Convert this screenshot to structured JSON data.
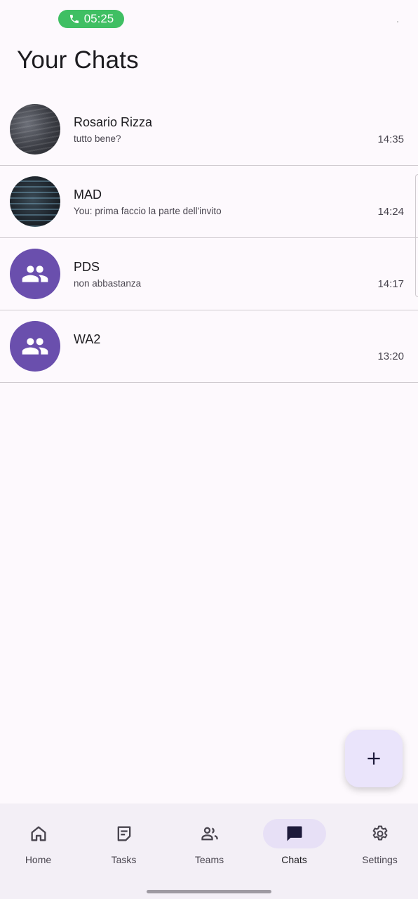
{
  "status_bar": {
    "call_time": "05:25",
    "call_icon": "phone-icon"
  },
  "page_title": "Your Chats",
  "chats": [
    {
      "name": "Rosario Rizza",
      "preview": "tutto bene?",
      "time": "14:35",
      "avatar": "photo"
    },
    {
      "name": "MAD",
      "preview": "You: prima faccio la parte dell'invito",
      "time": "14:24",
      "avatar": "photo"
    },
    {
      "name": "PDS",
      "preview": "non abbastanza",
      "time": "14:17",
      "avatar": "group-icon"
    },
    {
      "name": "WA2",
      "preview": "",
      "time": "13:20",
      "avatar": "group-icon"
    }
  ],
  "fab": {
    "icon": "plus-icon"
  },
  "nav": {
    "items": [
      {
        "label": "Home",
        "icon": "home-icon"
      },
      {
        "label": "Tasks",
        "icon": "tasks-icon"
      },
      {
        "label": "Teams",
        "icon": "teams-icon"
      },
      {
        "label": "Chats",
        "icon": "chat-icon",
        "active": true
      },
      {
        "label": "Settings",
        "icon": "settings-icon"
      }
    ]
  },
  "colors": {
    "accent": "#6a4fad",
    "call_pill": "#3fbf63",
    "fab_bg": "#eae4fb",
    "nav_active": "#e7e0f6",
    "background": "#fdf9fd"
  }
}
